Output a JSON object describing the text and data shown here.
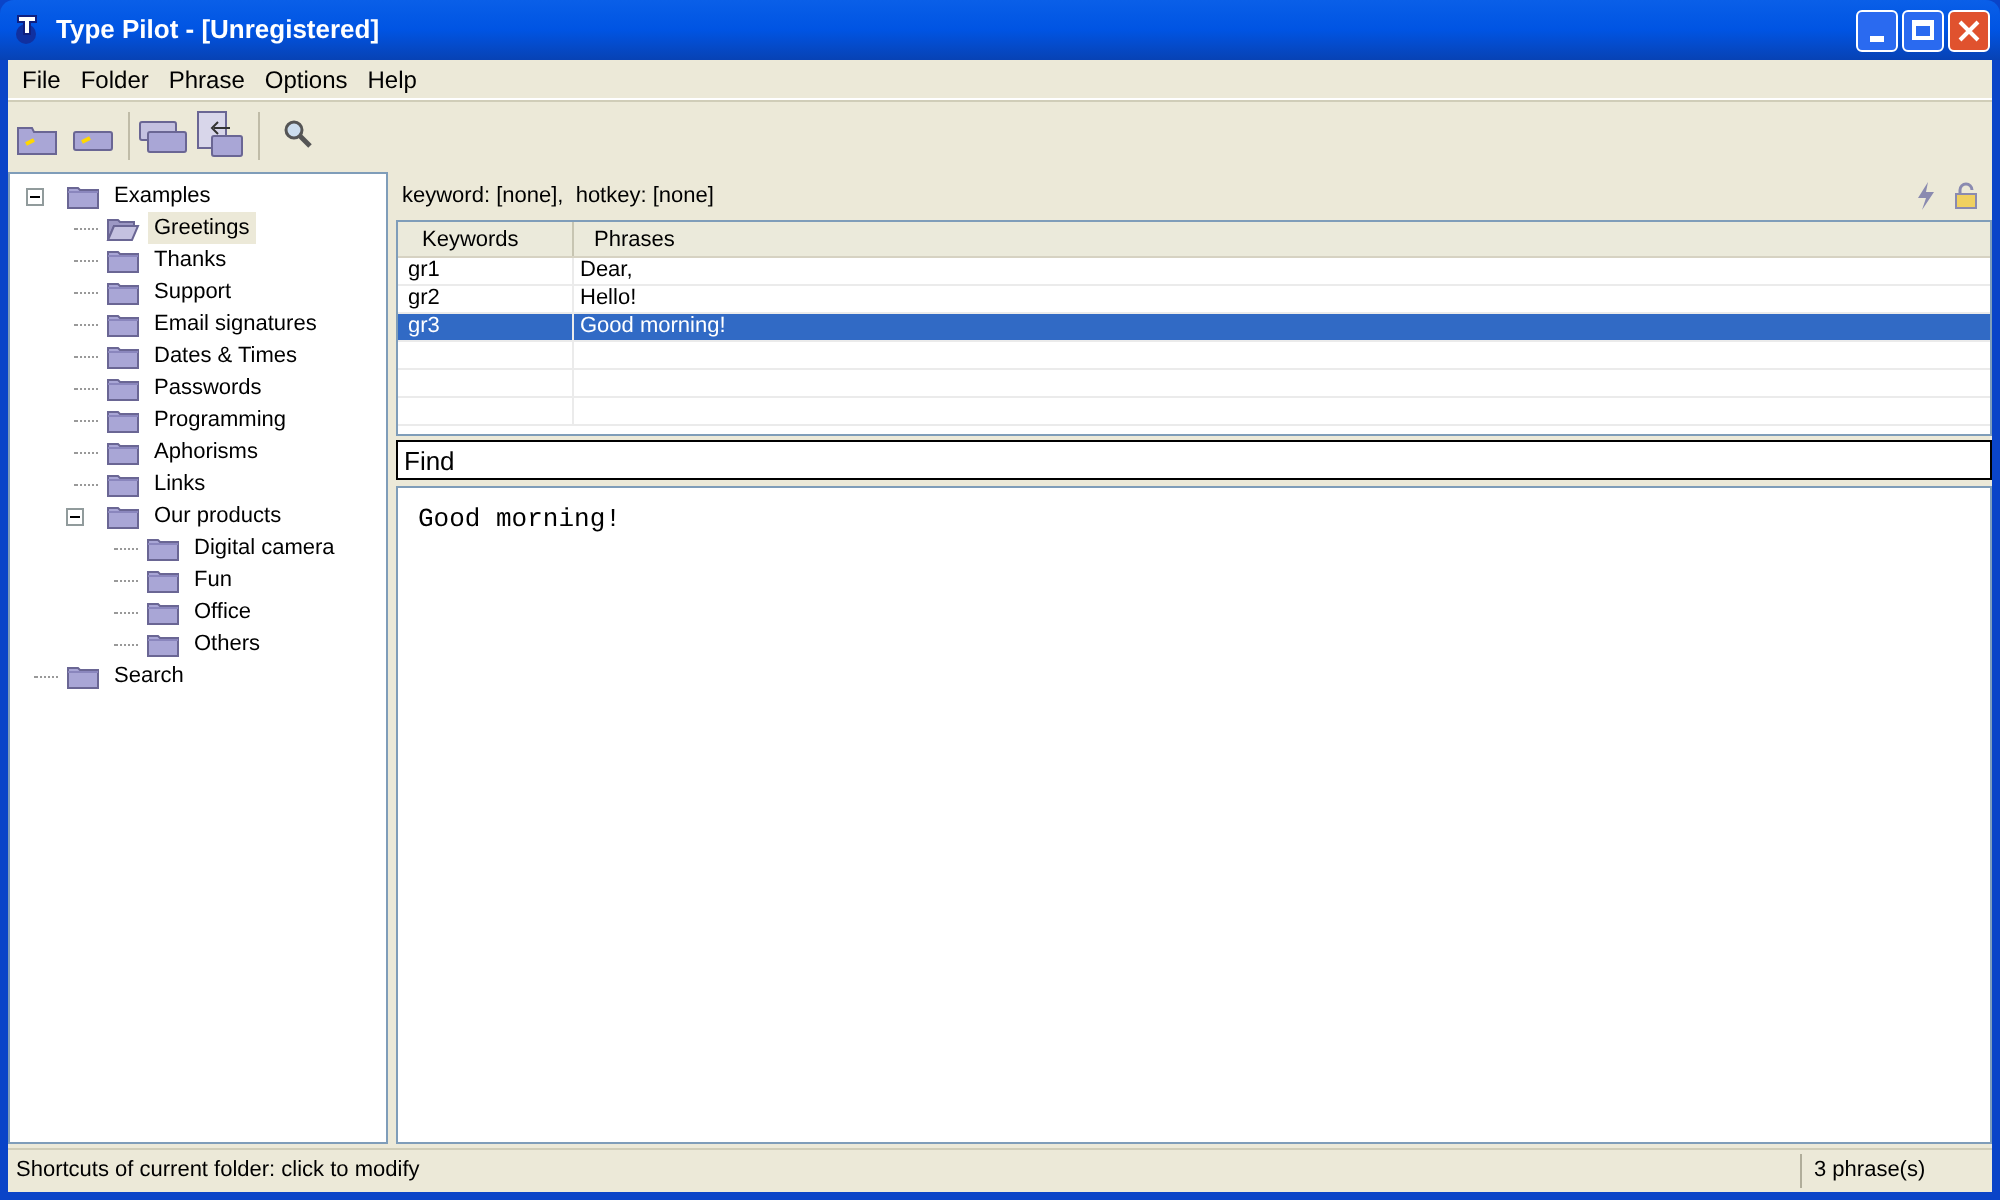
{
  "window": {
    "title": "Type Pilot - [Unregistered]"
  },
  "menu": [
    "File",
    "Folder",
    "Phrase",
    "Options",
    "Help"
  ],
  "tree": [
    {
      "label": "Examples",
      "selected": false,
      "expanded": true,
      "children": [
        {
          "label": "Greetings",
          "selected": true
        },
        {
          "label": "Thanks",
          "selected": false
        },
        {
          "label": "Support",
          "selected": false
        },
        {
          "label": "Email signatures",
          "selected": false
        },
        {
          "label": "Dates & Times",
          "selected": false
        },
        {
          "label": "Passwords",
          "selected": false
        },
        {
          "label": "Programming",
          "selected": false
        },
        {
          "label": "Aphorisms",
          "selected": false
        },
        {
          "label": "Links",
          "selected": false
        },
        {
          "label": "Our products",
          "selected": false,
          "expanded": true,
          "children": [
            {
              "label": "Digital camera",
              "selected": false
            },
            {
              "label": "Fun",
              "selected": false
            },
            {
              "label": "Office",
              "selected": false
            },
            {
              "label": "Others",
              "selected": false
            }
          ]
        }
      ]
    },
    {
      "label": "Search",
      "selected": false
    }
  ],
  "info": "keyword: [none],  hotkey: [none]",
  "table": {
    "columns": [
      "Keywords",
      "Phrases"
    ],
    "rows": [
      {
        "cells": [
          "gr1",
          "Dear,"
        ],
        "selected": false
      },
      {
        "cells": [
          "gr2",
          "Hello!"
        ],
        "selected": false
      },
      {
        "cells": [
          "gr3",
          "Good morning!"
        ],
        "selected": true
      }
    ]
  },
  "find_field": {
    "value": "Find"
  },
  "editor": {
    "value": "Good morning!"
  },
  "status_bar": {
    "left": "Shortcuts of current folder: click to modify",
    "right": "3 phrase(s)"
  }
}
